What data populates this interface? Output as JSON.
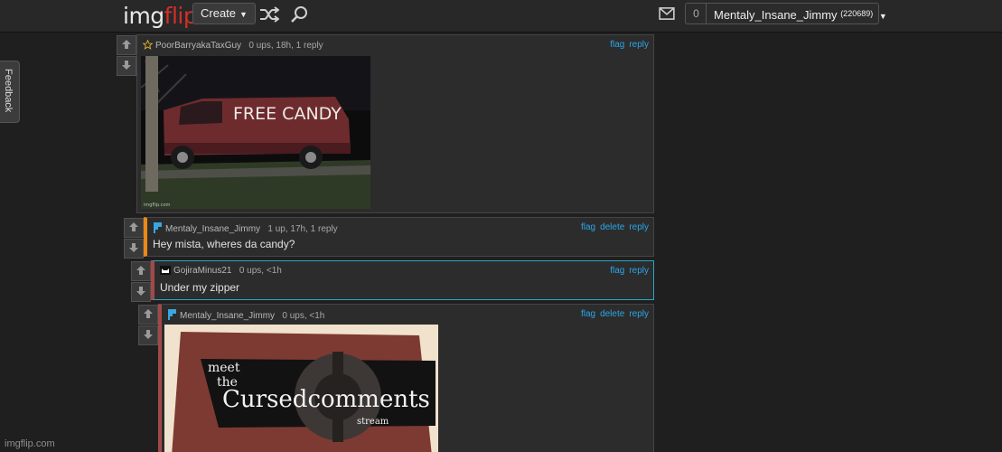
{
  "header": {
    "logo_main": "img",
    "logo_accent": "flip",
    "create_label": "Create",
    "notification_count": "0",
    "username": "Mentaly_Insane_Jimmy",
    "user_points": "(220689)"
  },
  "feedback_label": "Feedback",
  "comments": [
    {
      "username": "PoorBarryakaTaxGuy",
      "stats": "0 ups, 18h, 1 reply",
      "actions": [
        "flag",
        "reply"
      ],
      "image_text": "FREE CANDY",
      "image_credit": "imgflip.com"
    },
    {
      "username": "Mentaly_Insane_Jimmy",
      "stats": "1 up, 17h, 1 reply",
      "actions": [
        "flag",
        "delete",
        "reply"
      ],
      "text": "Hey mista, wheres da candy?"
    },
    {
      "username": "GojiraMinus21",
      "stats": "0 ups, <1h",
      "actions": [
        "flag",
        "reply"
      ],
      "text": "Under my zipper"
    },
    {
      "username": "Mentaly_Insane_Jimmy",
      "stats": "0 ups, <1h",
      "actions": [
        "flag",
        "delete",
        "reply"
      ],
      "image_text": {
        "line1": "meet",
        "line2": "the",
        "line3": "Cursedcomments",
        "line4": "stream"
      }
    }
  ],
  "watermark": "imgflip.com",
  "colors": {
    "background": "#1f1f1f",
    "link": "#2aa6e8",
    "logo_accent": "#d0302a",
    "thread_accent_orange": "#e8891a",
    "thread_accent_red": "#a34848",
    "reply_highlight_border": "#2aa6c8"
  }
}
